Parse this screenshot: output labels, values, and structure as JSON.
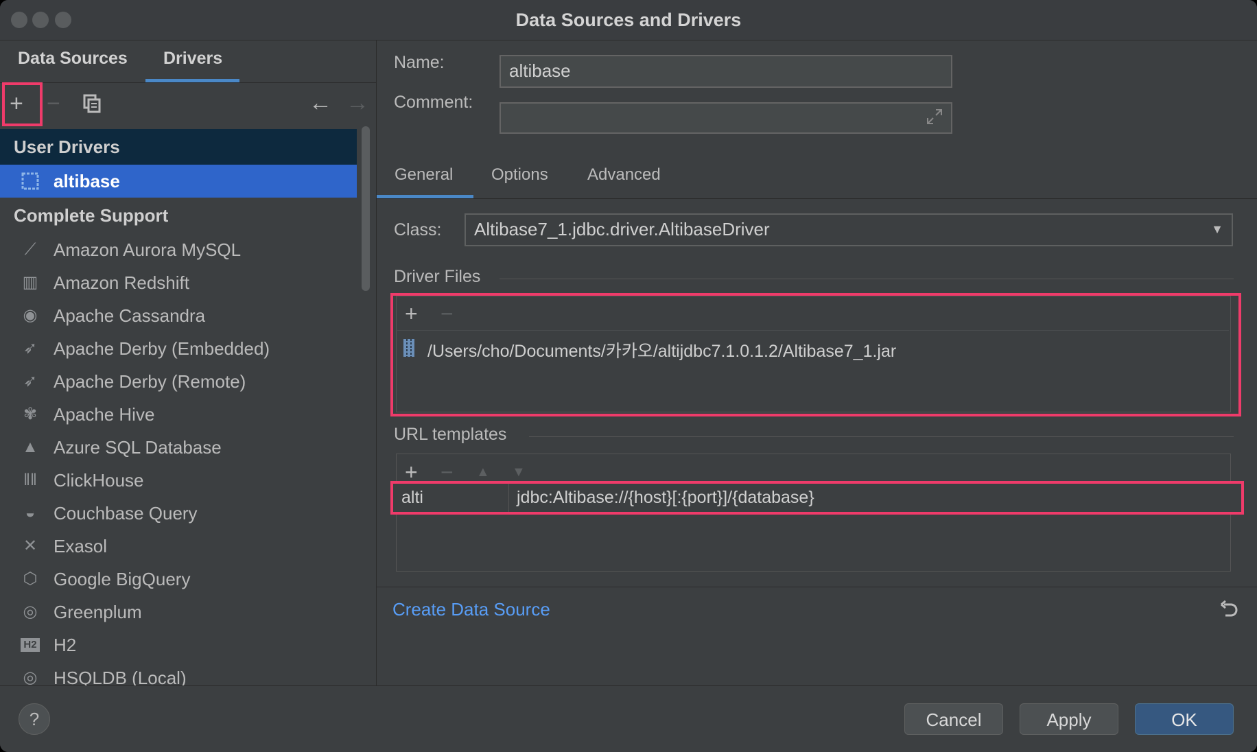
{
  "window": {
    "title": "Data Sources and Drivers"
  },
  "left": {
    "tabs": [
      "Data Sources",
      "Drivers"
    ],
    "active_tab": "Drivers",
    "toolbar": {
      "add_icon": "+",
      "remove_icon": "−",
      "copy_icon": "copy-icon",
      "back_icon": "←",
      "forward_icon": "→"
    },
    "groups": {
      "user": "User Drivers",
      "complete": "Complete Support"
    },
    "user_items": [
      {
        "label": "altibase",
        "icon": "driver-icon"
      }
    ],
    "items": [
      {
        "label": "Amazon Aurora MySQL",
        "icon": "aurora-icon",
        "glyph": "⟋"
      },
      {
        "label": "Amazon Redshift",
        "icon": "redshift-icon",
        "glyph": "▥"
      },
      {
        "label": "Apache Cassandra",
        "icon": "cassandra-icon",
        "glyph": "◉"
      },
      {
        "label": "Apache Derby (Embedded)",
        "icon": "derby-icon",
        "glyph": "➶"
      },
      {
        "label": "Apache Derby (Remote)",
        "icon": "derby-icon",
        "glyph": "➶"
      },
      {
        "label": "Apache Hive",
        "icon": "hive-icon",
        "glyph": "✾"
      },
      {
        "label": "Azure SQL Database",
        "icon": "azure-icon",
        "glyph": "▲"
      },
      {
        "label": "ClickHouse",
        "icon": "clickhouse-icon",
        "glyph": "‖‖"
      },
      {
        "label": "Couchbase Query",
        "icon": "couchbase-icon",
        "glyph": "◒"
      },
      {
        "label": "Exasol",
        "icon": "exasol-icon",
        "glyph": "✕"
      },
      {
        "label": "Google BigQuery",
        "icon": "bigquery-icon",
        "glyph": "⬡"
      },
      {
        "label": "Greenplum",
        "icon": "greenplum-icon",
        "glyph": "◎"
      },
      {
        "label": "H2",
        "icon": "h2-icon",
        "glyph": "H2"
      },
      {
        "label": "HSQLDB (Local)",
        "icon": "hsqldb-icon",
        "glyph": "◎"
      }
    ]
  },
  "form": {
    "name_label": "Name:",
    "name_value": "altibase",
    "comment_label": "Comment:",
    "comment_value": "",
    "tabs": [
      "General",
      "Options",
      "Advanced"
    ],
    "active_tab": "General",
    "class_label": "Class:",
    "class_value": "Altibase7_1.jdbc.driver.AltibaseDriver",
    "driver_files_title": "Driver Files",
    "driver_files": [
      "/Users/cho/Documents/카카오/altijdbc7.1.0.1.2/Altibase7_1.jar"
    ],
    "url_templates_title": "URL templates",
    "url_templates": [
      {
        "name": "alti",
        "template": "jdbc:Altibase://{host}[:{port}]/{database}"
      }
    ],
    "create_link": "Create Data Source"
  },
  "footer": {
    "help": "?",
    "cancel": "Cancel",
    "apply": "Apply",
    "ok": "OK"
  },
  "colors": {
    "accent": "#4a88c7",
    "selection": "#2f65ca",
    "highlight": "#ef3b6a",
    "link": "#589df6"
  }
}
